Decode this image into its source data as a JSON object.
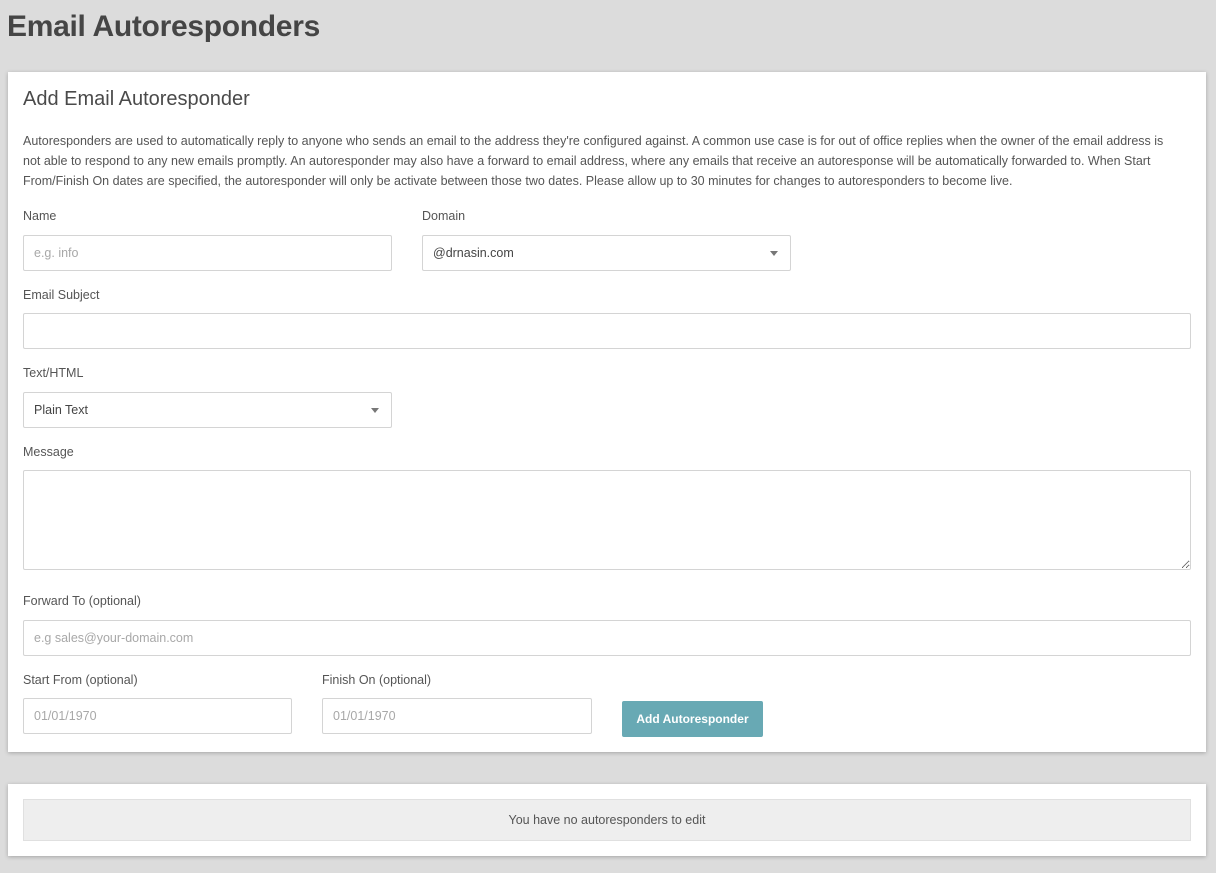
{
  "page": {
    "title": "Email Autoresponders"
  },
  "form": {
    "heading": "Add Email Autoresponder",
    "description": "Autoresponders are used to automatically reply to anyone who sends an email to the address they're configured against. A common use case is for out of office replies when the owner of the email address is not able to respond to any new emails promptly. An autoresponder may also have a forward to email address, where any emails that receive an autoresponse will be automatically forwarded to. When Start From/Finish On dates are specified, the autoresponder will only be activate between those two dates. Please allow up to 30 minutes for changes to autoresponders to become live.",
    "name": {
      "label": "Name",
      "placeholder": "e.g. info",
      "value": ""
    },
    "domain": {
      "label": "Domain",
      "selected": "@drnasin.com"
    },
    "subject": {
      "label": "Email Subject",
      "value": ""
    },
    "format": {
      "label": "Text/HTML",
      "selected": "Plain Text"
    },
    "message": {
      "label": "Message",
      "value": ""
    },
    "forward": {
      "label": "Forward To (optional)",
      "placeholder": "e.g sales@your-domain.com",
      "value": ""
    },
    "start": {
      "label": "Start From (optional)",
      "placeholder": "01/01/1970"
    },
    "finish": {
      "label": "Finish On (optional)",
      "placeholder": "01/01/1970"
    },
    "submit_label": "Add Autoresponder"
  },
  "list": {
    "empty_message": "You have no autoresponders to edit"
  },
  "colors": {
    "button": "#68a9b4",
    "background": "#dcdcdc"
  },
  "icons": {
    "select_caret": "chevron-down-icon"
  }
}
